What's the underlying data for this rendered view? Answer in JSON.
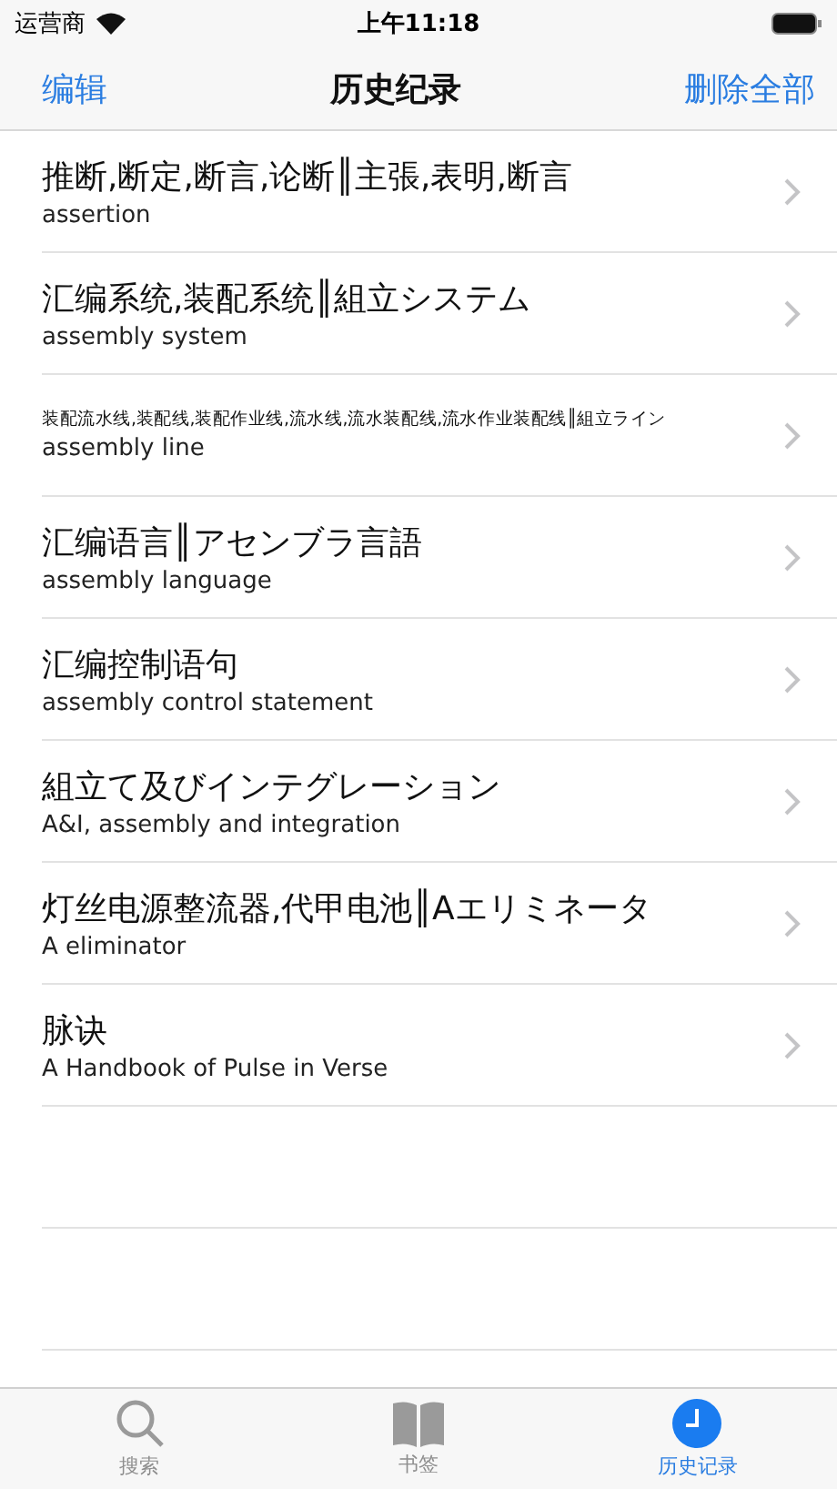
{
  "status_bar": {
    "carrier": "运营商",
    "time": "上午11:18"
  },
  "nav": {
    "left": "编辑",
    "title": "历史纪录",
    "right": "删除全部"
  },
  "rows": [
    {
      "kind": "normal",
      "title": "推断,断定,断言,论断║主張,表明,断言",
      "subtitle": "assertion"
    },
    {
      "kind": "normal",
      "title": "汇编系统,装配系统║組立システム",
      "subtitle": "assembly system"
    },
    {
      "kind": "compact",
      "title": "装配流水线,装配线,装配作业线,流水线,流水装配线,流水作业装配线║組立ライン",
      "subtitle": "assembly line"
    },
    {
      "kind": "normal",
      "title": "汇编语言║アセンブラ言語",
      "subtitle": "assembly language"
    },
    {
      "kind": "normal",
      "title": "汇编控制语句",
      "subtitle": "assembly control statement"
    },
    {
      "kind": "normal",
      "title": "組立て及びインテグレーション",
      "subtitle": "A&I, assembly and integration"
    },
    {
      "kind": "normal",
      "title": "灯丝电源整流器,代甲电池║Aエリミネータ",
      "subtitle": "A eliminator"
    },
    {
      "kind": "normal",
      "title": "脉诀",
      "subtitle": "A Handbook of Pulse in Verse"
    }
  ],
  "tabs": [
    {
      "kind": "search",
      "label": "搜索",
      "selected": false
    },
    {
      "kind": "bookmarks",
      "label": "书签",
      "selected": false
    },
    {
      "kind": "history",
      "label": "历史记录",
      "selected": true
    }
  ]
}
